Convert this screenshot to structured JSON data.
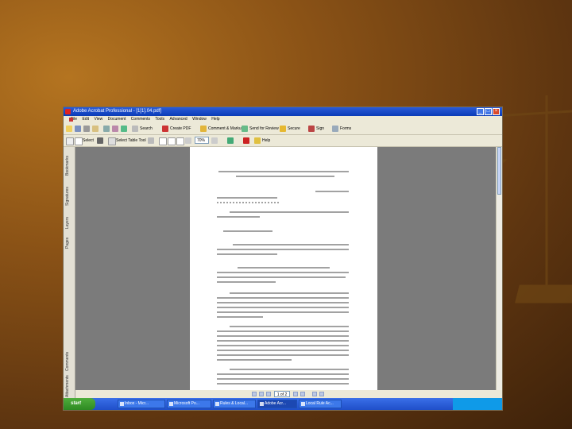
{
  "window": {
    "title": "Adobe Acrobat Professional - [1[1].04.pdf]"
  },
  "menu": [
    "File",
    "Edit",
    "View",
    "Document",
    "Comments",
    "Tools",
    "Advanced",
    "Window",
    "Help"
  ],
  "toolbar1": {
    "search_label": "Search",
    "create_pdf_label": "Create PDF",
    "comment_label": "Comment & Markup",
    "send_review_label": "Send for Review",
    "secure_label": "Secure",
    "sign_label": "Sign",
    "forms_label": "Forms"
  },
  "toolbar2": {
    "select_label": "Select",
    "snapshot_label": "Select Table Tool",
    "zoom_value": "70%",
    "help_label": "Help"
  },
  "sidebar_tabs": [
    "Bookmarks",
    "Signatures",
    "Layers",
    "Pages",
    "Comments",
    "Attachments"
  ],
  "navigation": {
    "page_indicator": "1 of 2"
  },
  "taskbar": {
    "start_label": "start",
    "buttons": [
      "Inbox - Micr...",
      "Microsoft Po...",
      "Rules & Local...",
      "Adobe Acr...",
      "Local Rule Ac..."
    ],
    "active_index": 3
  }
}
